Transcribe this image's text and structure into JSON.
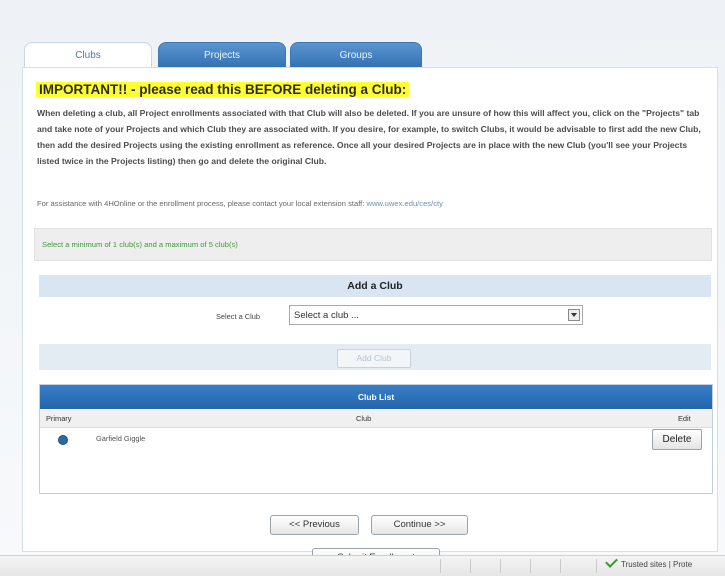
{
  "tabs": [
    {
      "label": "Clubs"
    },
    {
      "label": "Projects"
    },
    {
      "label": "Groups"
    }
  ],
  "warning": {
    "title": "IMPORTANT!! - please read this BEFORE deleting a Club:",
    "body": "When deleting a club, all Project enrollments associated with that Club will also be deleted.  If you are unsure of how this will affect you, click on the \"Projects\" tab and take note of your Projects and which Club they are associated with.  If you desire, for example, to switch Clubs, it would be advisable to first add the new Club, then add the desired Projects using the existing enrollment as reference.  Once all your desired Projects are in place with the new Club (you'll see your Projects listed twice in the Projects listing) then go and delete the original Club.",
    "assist_text": "For assistance with 4HOnline or the enrollment process, please contact your local extension staff:",
    "assist_link": "www.uwex.edu/ces/cty"
  },
  "notice": "Select a minimum of 1 club(s) and a maximum of 5 club(s)",
  "add_club": {
    "header": "Add a Club",
    "select_label": "Select a Club",
    "select_value": "Select a club ...",
    "add_button": "Add Club"
  },
  "club_list": {
    "header": "Club List",
    "columns": [
      "Primary",
      "Club",
      "Edit"
    ],
    "rows": [
      {
        "club": "Garfield Giggle",
        "delete_label": "Delete"
      }
    ]
  },
  "nav": {
    "previous": "<< Previous",
    "continue": "Continue >>",
    "submit": "Submit Enrollment"
  },
  "status_bar": {
    "zone": "Trusted sites | Prote"
  }
}
